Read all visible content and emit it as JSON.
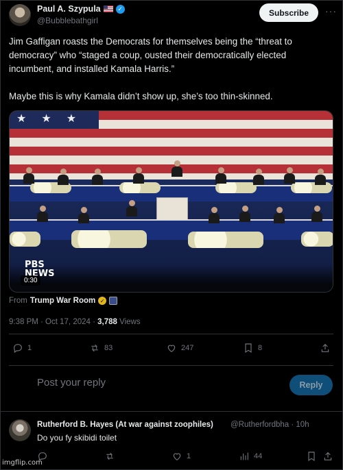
{
  "tweet": {
    "author": {
      "display_name": "Paul A. Szypula",
      "handle": "@Bubblebathgirl",
      "flag_icon": "us-flag-icon",
      "verified": true
    },
    "subscribe_label": "Subscribe",
    "more_icon": "more-dots-icon",
    "text_lines": [
      "Jim Gaffigan roasts the Democrats for themselves being the “threat to democracy” who “staged a coup, ousted their democratically elected incumbent, and installed Kamala Harris.”",
      "Maybe this is why Kamala didn’t show up, she’s too thin-skinned."
    ],
    "media": {
      "logo_line1": "PBS",
      "logo_line2": "NEWS",
      "duration": "0:30"
    },
    "from_label": "From",
    "from_source": "Trump War Room",
    "timestamp": "9:38 PM · Oct 17, 2024 ·",
    "views_count": "3,788",
    "views_label": "Views",
    "stats": {
      "replies": "1",
      "reposts": "83",
      "likes": "247",
      "bookmarks": "8"
    }
  },
  "reply_composer": {
    "placeholder": "Post your reply",
    "button_label": "Reply"
  },
  "comment": {
    "display_name": "Rutherford B. Hayes (At war against zoophiles)",
    "handle_time": "@Rutherfordbha · 10h",
    "text": "Do you fy skibidi toilet",
    "stats": {
      "likes": "1",
      "views": "44"
    }
  },
  "colors": {
    "background": "#000000",
    "text": "#e7e9ea",
    "muted": "#71767b",
    "accent": "#1d9bf0"
  },
  "watermark": "imgflip.com"
}
